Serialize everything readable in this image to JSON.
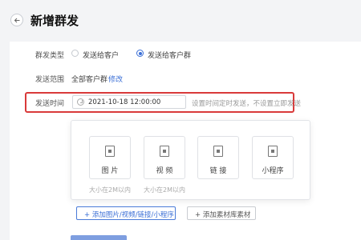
{
  "header": {
    "title": "新增群发"
  },
  "form": {
    "type": {
      "label": "群发类型",
      "options": [
        {
          "label": "发送给客户",
          "selected": false
        },
        {
          "label": "发送给客户群",
          "selected": true
        }
      ]
    },
    "range": {
      "label": "发送范围",
      "value": "全部客户群",
      "edit_link": "修改"
    },
    "time": {
      "label": "发送时间",
      "value": "2021-10-18 12:00:00",
      "hint": "设置时间定时发送，不设置立即发送",
      "icon": "clock-icon"
    },
    "attachments": {
      "tiles": [
        {
          "label": "图 片",
          "icon": "image-file-icon",
          "limit": "大小在2M以内"
        },
        {
          "label": "视 频",
          "icon": "video-file-icon",
          "limit": "大小在2M以内"
        },
        {
          "label": "链 接",
          "icon": "link-file-icon"
        },
        {
          "label": "小程序",
          "icon": "miniprogram-file-icon"
        }
      ],
      "add_button": "+ 添加图片/视频/链接/小程序",
      "library_button": "+ 添加素材库素材"
    }
  },
  "colors": {
    "accent": "#3b6fd6",
    "highlight": "#d93a3a",
    "background": "#f3f4f6"
  }
}
